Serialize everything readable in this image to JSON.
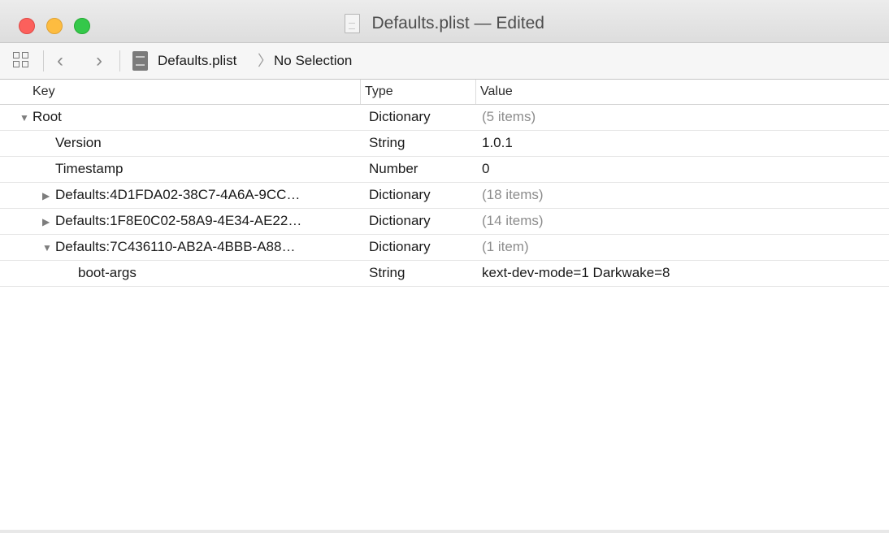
{
  "window": {
    "title": "Defaults.plist — Edited"
  },
  "jump_bar": {
    "file_label": "Defaults.plist",
    "separator": "〉",
    "selection_label": "No Selection"
  },
  "columns": {
    "key": "Key",
    "type": "Type",
    "value": "Value"
  },
  "rows": [
    {
      "key": "Root",
      "type": "Dictionary",
      "value": "(5 items)",
      "expanded": "open"
    },
    {
      "key": "Version",
      "type": "String",
      "value": "1.0.1"
    },
    {
      "key": "Timestamp",
      "type": "Number",
      "value": "0"
    },
    {
      "key": "Defaults:4D1FDA02-38C7-4A6A-9CC…",
      "type": "Dictionary",
      "value": "(18 items)",
      "expanded": "closed"
    },
    {
      "key": "Defaults:1F8E0C02-58A9-4E34-AE22…",
      "type": "Dictionary",
      "value": "(14 items)",
      "expanded": "closed"
    },
    {
      "key": "Defaults:7C436110-AB2A-4BBB-A88…",
      "type": "Dictionary",
      "value": "(1 item)",
      "expanded": "open"
    },
    {
      "key": "boot-args",
      "type": "String",
      "value": "kext-dev-mode=1 Darkwake=8"
    }
  ],
  "icons": {
    "disclosure_open": "▼",
    "disclosure_closed": "▶",
    "back": "‹",
    "forward": "›"
  },
  "colors": {
    "close": "#fc605c",
    "minimize": "#fdbc40",
    "zoom": "#34c84a"
  }
}
